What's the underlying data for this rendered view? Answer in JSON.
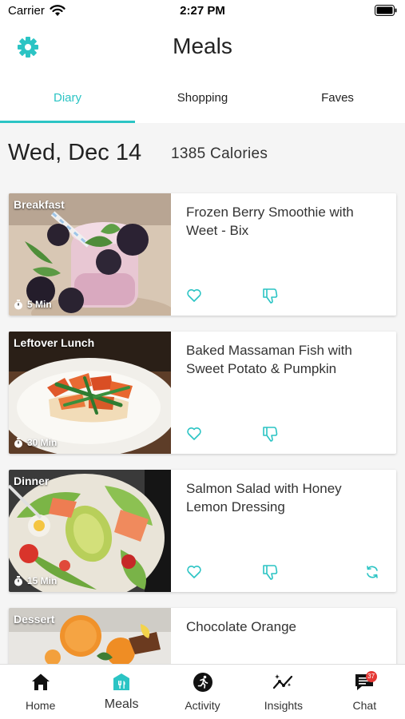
{
  "status_bar": {
    "carrier": "Carrier",
    "time": "2:27 PM"
  },
  "header": {
    "title": "Meals"
  },
  "tabs": [
    {
      "label": "Diary",
      "active": true
    },
    {
      "label": "Shopping",
      "active": false
    },
    {
      "label": "Faves",
      "active": false
    }
  ],
  "day": {
    "date": "Wed, Dec 14",
    "calories": "1385 Calories"
  },
  "meals": [
    {
      "label": "Breakfast",
      "time": "5 Min",
      "title": "Frozen Berry Smoothie with Weet - Bix",
      "image": "berry-smoothie",
      "has_swap": false
    },
    {
      "label": "Leftover Lunch",
      "time": "30 Min",
      "title": "Baked Massaman Fish with Sweet Potato & Pumpkin",
      "image": "massaman-fish",
      "has_swap": false
    },
    {
      "label": "Dinner",
      "time": "15 Min",
      "title": "Salmon Salad with Honey Lemon Dressing",
      "image": "salmon-salad",
      "has_swap": true
    },
    {
      "label": "Dessert",
      "time": "",
      "title": "Chocolate Orange",
      "image": "chocolate-orange",
      "has_swap": false
    }
  ],
  "tab_bar": {
    "items": [
      {
        "label": "Home",
        "icon": "home-icon",
        "active": false
      },
      {
        "label": "Meals",
        "icon": "meals-icon",
        "active": true
      },
      {
        "label": "Activity",
        "icon": "activity-icon",
        "active": false
      },
      {
        "label": "Insights",
        "icon": "insights-icon",
        "active": false
      },
      {
        "label": "Chat",
        "icon": "chat-icon",
        "active": false
      }
    ],
    "chat_badge": "37"
  },
  "colors": {
    "accent": "#2bc4c4",
    "badge": "#e53935"
  }
}
